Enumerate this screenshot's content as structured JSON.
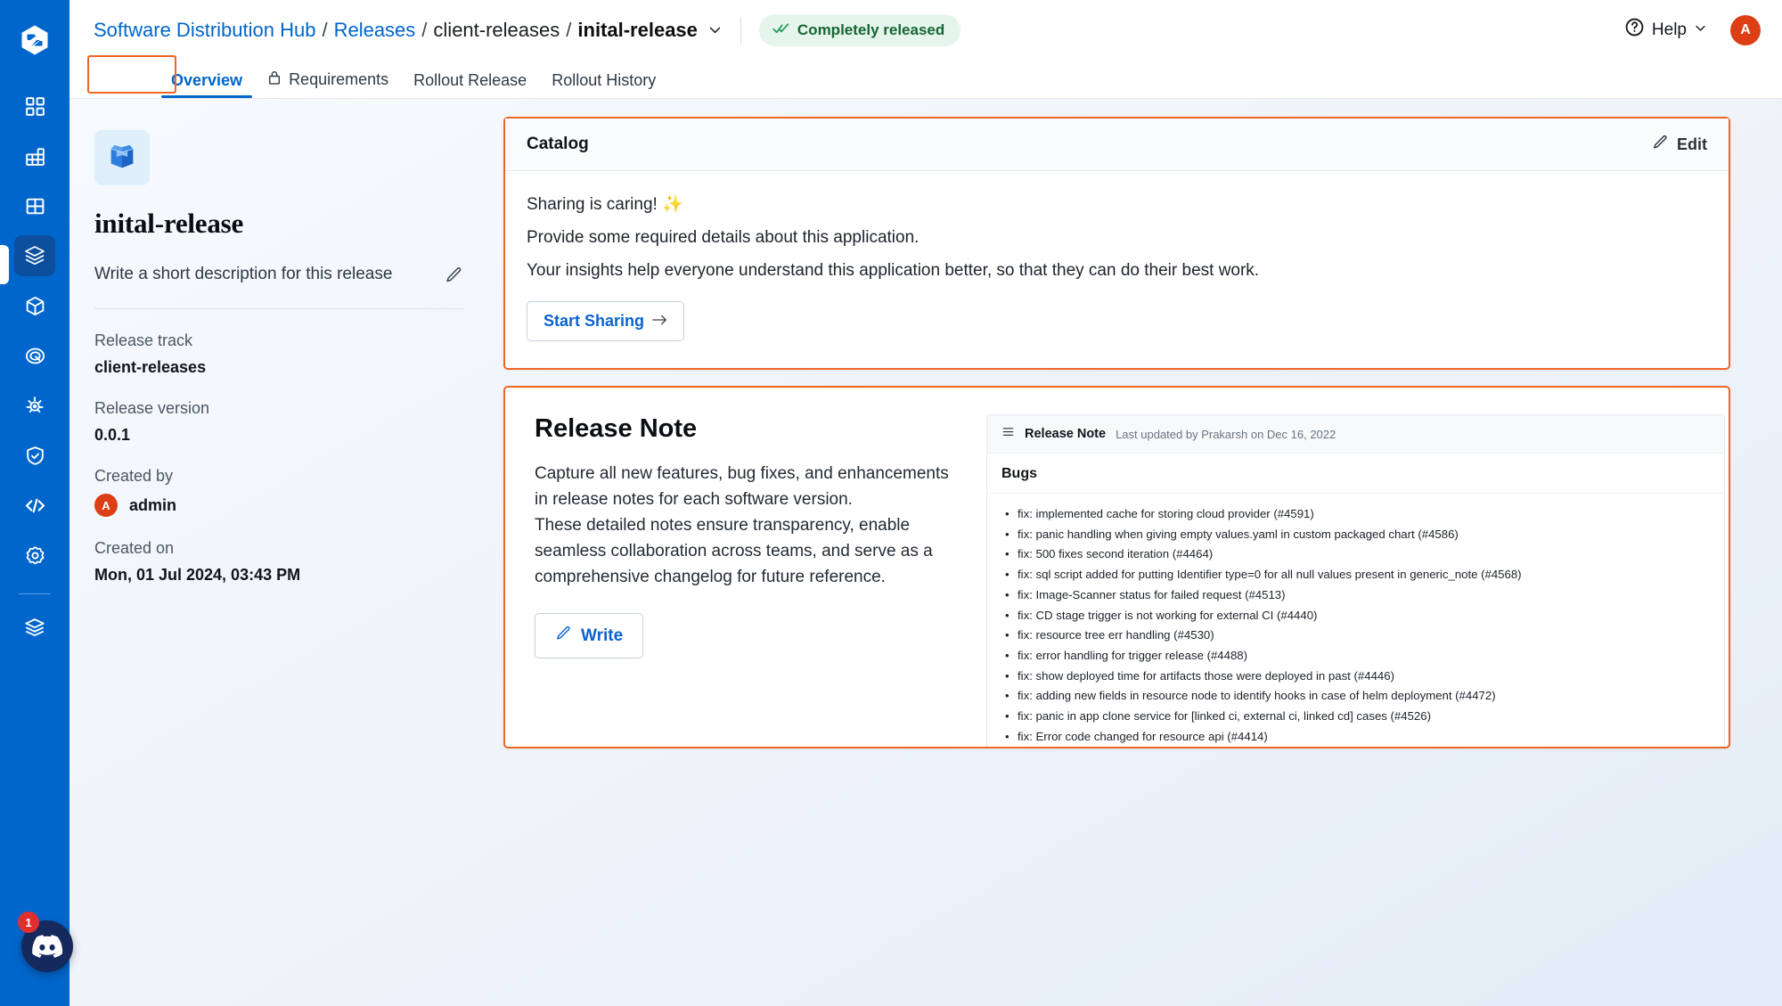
{
  "brand": {
    "logo_icon": "devtron-logo-icon",
    "accent": "#0066cc",
    "highlight": "#f06524"
  },
  "rail": {
    "items": [
      {
        "icon": "apps-grid-icon",
        "name": "applications"
      },
      {
        "icon": "jobs-grid-icon",
        "name": "jobs"
      },
      {
        "icon": "app-groups-icon",
        "name": "application-groups"
      },
      {
        "icon": "software-distribution-hub-icon",
        "name": "software-distribution-hub",
        "active": true
      },
      {
        "icon": "cube-icon",
        "name": "resource-browser"
      },
      {
        "icon": "target-icon",
        "name": "chart-store"
      },
      {
        "icon": "helm-wheel-icon",
        "name": "deployments"
      },
      {
        "icon": "shield-check-icon",
        "name": "security"
      },
      {
        "icon": "code-icon",
        "name": "bulk-edit"
      },
      {
        "icon": "gear-icon",
        "name": "global-configurations"
      },
      {
        "icon": "stack-manager-icon",
        "name": "devtron-stack-manager"
      }
    ],
    "discord": {
      "icon": "discord-icon",
      "badge": "1"
    }
  },
  "topbar": {
    "breadcrumbs": [
      {
        "label": "Software Distribution Hub",
        "type": "link"
      },
      {
        "label": "Releases",
        "type": "link"
      },
      {
        "label": "client-releases",
        "type": "static"
      },
      {
        "label": "inital-release",
        "type": "current"
      }
    ],
    "separator": "/",
    "dropdown_icon": "chevron-down-icon",
    "status": {
      "label": "Completely released",
      "icon": "double-check-icon",
      "color": "#166534",
      "bg": "#e6f5ec"
    },
    "help": {
      "label": "Help",
      "icon": "question-circle-icon",
      "chevron": "chevron-down-icon"
    },
    "avatar": {
      "initial": "A",
      "color": "#dc3e15"
    }
  },
  "tabs": [
    {
      "label": "Overview",
      "active": true,
      "icon": null
    },
    {
      "label": "Requirements",
      "active": false,
      "icon": "lock-icon"
    },
    {
      "label": "Rollout Release",
      "active": false,
      "icon": null
    },
    {
      "label": "Rollout History",
      "active": false,
      "icon": null
    }
  ],
  "info": {
    "package_icon": "package-box-icon",
    "title": "inital-release",
    "description_placeholder": "Write a short description for this release",
    "edit_icon": "pencil-icon",
    "fields": [
      {
        "label": "Release track",
        "value": "client-releases"
      },
      {
        "label": "Release version",
        "value": "0.0.1"
      }
    ],
    "created_by": {
      "label": "Created by",
      "value": "admin",
      "avatar_initial": "A"
    },
    "created_on": {
      "label": "Created on",
      "value": "Mon, 01 Jul 2024, 03:43 PM"
    }
  },
  "catalog": {
    "title": "Catalog",
    "edit": {
      "label": "Edit",
      "icon": "pencil-icon"
    },
    "lines": [
      "Sharing is caring! ✨",
      "Provide some required details about this application.",
      "Your insights help everyone understand this application better, so that they can do their best work."
    ],
    "cta": {
      "label": "Start Sharing",
      "icon": "arrow-right-icon"
    }
  },
  "release_note": {
    "title": "Release Note",
    "paragraphs": [
      "Capture all new features, bug fixes, and enhancements in release notes for each software version.",
      "These detailed notes ensure transparency, enable seamless collaboration across teams, and serve as a comprehensive changelog for future reference."
    ],
    "cta": {
      "label": "Write",
      "icon": "pencil-icon"
    },
    "preview": {
      "header_icon": "list-icon",
      "header_title": "Release Note",
      "header_meta": "Last updated by Prakarsh on Dec 16, 2022",
      "section_title": "Bugs",
      "items": [
        "fix: implemented cache for storing cloud provider (#4591)",
        "fix: panic handling when giving empty values.yaml in custom packaged chart (#4586)",
        "fix: 500 fixes second iteration (#4464)",
        "fix: sql script added for putting Identifier type=0 for all null values present in generic_note (#4568)",
        "fix: Image-Scanner status for failed request (#4513)",
        "fix: CD stage trigger is not working for external CI (#4440)",
        "fix: resource tree err handling (#4530)",
        "fix: error handling for trigger release (#4488)",
        "fix: show deployed time for artifacts those were deployed in past (#4446)",
        "fix: adding new fields in resource node to identify hooks in case of helm deployment (#4472)",
        "fix: panic in app clone service for [linked ci, external ci, linked cd] cases (#4526)",
        "fix: Error code changed for resource api (#4414)"
      ]
    }
  }
}
